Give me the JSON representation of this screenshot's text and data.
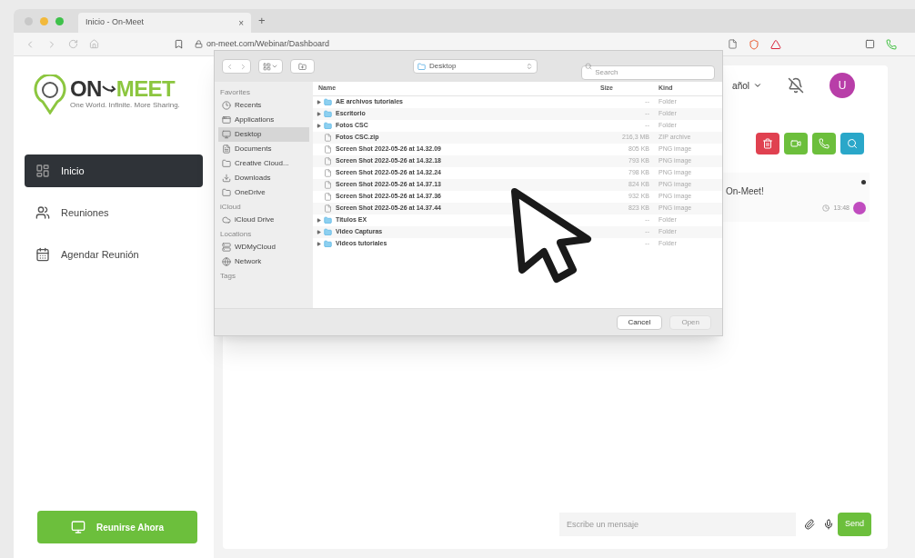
{
  "browser": {
    "tab_title": "Inicio - On-Meet",
    "new_tab": "+",
    "close_tab": "×",
    "url": "on-meet.com/Webinar/Dashboard"
  },
  "logo": {
    "left": "ON",
    "right": "MEET",
    "tagline": "One World. Infinite. More Sharing."
  },
  "nav": [
    {
      "label": "Inicio",
      "selected": true,
      "kind": "home"
    },
    {
      "label": "Reuniones",
      "selected": false,
      "kind": "meetings"
    },
    {
      "label": "Agendar Reunión",
      "selected": false,
      "kind": "calendar"
    }
  ],
  "join_button": "Reunirse Ahora",
  "header": {
    "language": "añol",
    "avatar": "U"
  },
  "actions": [
    {
      "kind": "trash",
      "color": "#e04150"
    },
    {
      "kind": "video",
      "color": "#6cbf3c"
    },
    {
      "kind": "phone",
      "color": "#6cbf3c"
    },
    {
      "kind": "search",
      "color": "#2aa7c9"
    }
  ],
  "message": {
    "text": "On-Meet!",
    "time": "13:48"
  },
  "chat": {
    "placeholder": "Escribe un mensaje",
    "send": "Send"
  },
  "dialog": {
    "location": "Desktop",
    "search_placeholder": "Search",
    "sections": [
      {
        "title": "Favorites",
        "items": [
          {
            "label": "Recents",
            "selected": false
          },
          {
            "label": "Applications",
            "selected": false
          },
          {
            "label": "Desktop",
            "selected": true
          },
          {
            "label": "Documents",
            "selected": false
          },
          {
            "label": "Creative Cloud...",
            "selected": false
          },
          {
            "label": "Downloads",
            "selected": false
          },
          {
            "label": "OneDrive",
            "selected": false
          }
        ]
      },
      {
        "title": "iCloud",
        "items": [
          {
            "label": "iCloud Drive",
            "selected": false
          }
        ]
      },
      {
        "title": "Locations",
        "items": [
          {
            "label": "WDMyCloud",
            "selected": false
          },
          {
            "label": "Network",
            "selected": false
          }
        ]
      },
      {
        "title": "Tags"
      }
    ],
    "columns": [
      "Name",
      "Size",
      "Kind"
    ],
    "rows": [
      {
        "kind": "folder",
        "name": "AE archivos tutoriales",
        "size": "--",
        "type": "Folder"
      },
      {
        "kind": "folder",
        "name": "Escritorio",
        "size": "--",
        "type": "Folder"
      },
      {
        "kind": "folder",
        "name": "Fotos CSC",
        "size": "--",
        "type": "Folder"
      },
      {
        "kind": "file",
        "name": "Fotos CSC.zip",
        "size": "216,3 MB",
        "type": "ZIP archive"
      },
      {
        "kind": "file",
        "name": "Screen Shot 2022-05-26 at 14.32.09",
        "size": "805 KB",
        "type": "PNG image"
      },
      {
        "kind": "file",
        "name": "Screen Shot 2022-05-26 at 14.32.18",
        "size": "793 KB",
        "type": "PNG image"
      },
      {
        "kind": "file",
        "name": "Screen Shot 2022-05-26 at 14.32.24",
        "size": "798 KB",
        "type": "PNG image"
      },
      {
        "kind": "file",
        "name": "Screen Shot 2022-05-26 at 14.37.13",
        "size": "824 KB",
        "type": "PNG image"
      },
      {
        "kind": "file",
        "name": "Screen Shot 2022-05-26 at 14.37.36",
        "size": "932 KB",
        "type": "PNG image"
      },
      {
        "kind": "file",
        "name": "Screen Shot 2022-05-26 at 14.37.44",
        "size": "823 KB",
        "type": "PNG image"
      },
      {
        "kind": "folder",
        "name": "Titulos EX",
        "size": "--",
        "type": "Folder"
      },
      {
        "kind": "folder",
        "name": "Video Capturas",
        "size": "--",
        "type": "Folder"
      },
      {
        "kind": "folder",
        "name": "Videos tutoriales",
        "size": "--",
        "type": "Folder"
      }
    ],
    "buttons": [
      {
        "label": "Cancel",
        "disabled": false
      },
      {
        "label": "Open",
        "disabled": true
      }
    ]
  }
}
